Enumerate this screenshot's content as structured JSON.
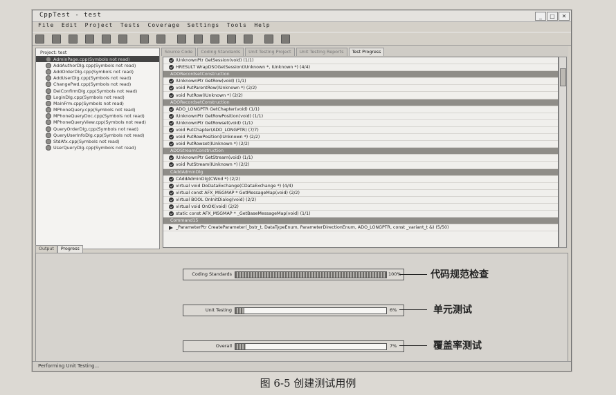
{
  "window": {
    "title": "CppTest - test",
    "controls": [
      "_",
      "□",
      "✕"
    ]
  },
  "menu": [
    "File",
    "Edit",
    "Project",
    "Tests",
    "Coverage",
    "Settings",
    "Tools",
    "Help"
  ],
  "tree": {
    "root": "Project: test",
    "items": [
      "AdminPage.cpp(Symbols not read)",
      "AddAuthorDlg.cpp(Symbols not read)",
      "AddOrderDlg.cpp(Symbols not read)",
      "AddUserDlg.cpp(Symbols not read)",
      "ChangePwd.cpp(Symbols not read)",
      "DelConfirmDlg.cpp(Symbols not read)",
      "LoginDlg.cpp(Symbols not read)",
      "MainFrm.cpp(Symbols not read)",
      "MPhoneQuery.cpp(Symbols not read)",
      "MPhoneQueryDoc.cpp(Symbols not read)",
      "MPhoneQueryView.cpp(Symbols not read)",
      "QueryOrderDlg.cpp(Symbols not read)",
      "QueryUserInfoDlg.cpp(Symbols not read)",
      "StdAfx.cpp(Symbols not read)",
      "UserQueryDlg.cpp(Symbols not read)"
    ]
  },
  "tabs": [
    "Source Code",
    "Coding Standards",
    "Unit Testing Project",
    "Unit Testing Reports",
    "Test Progress"
  ],
  "active_tab": "Test Progress",
  "test_rows": [
    {
      "kind": "test",
      "text": "IUnknownPtr GetSession(void) (1/1)"
    },
    {
      "kind": "test",
      "text": "HRESULT WrapDSOGetSession(IUnknown *, IUnknown *) (4/4)"
    },
    {
      "kind": "group",
      "text": "ADORecordsetConstruction"
    },
    {
      "kind": "test",
      "text": "IUnknownPtr GetRow(void) (1/1)"
    },
    {
      "kind": "test",
      "text": "void PutParentRow(IUnknown *) (2/2)"
    },
    {
      "kind": "test",
      "text": "void PutRow(IUnknown *) (2/2)"
    },
    {
      "kind": "group",
      "text": "ADORecordsetConstruction"
    },
    {
      "kind": "test",
      "text": "ADO_LONGPTR GetChapter(void) (1/1)"
    },
    {
      "kind": "test",
      "text": "IUnknownPtr GetRowPosition(void) (1/1)"
    },
    {
      "kind": "test",
      "text": "IUnknownPtr GetRowset(void) (1/1)"
    },
    {
      "kind": "test",
      "text": "void PutChapter(ADO_LONGPTR) (7/7)"
    },
    {
      "kind": "test",
      "text": "void PutRowPosition(IUnknown *) (2/2)"
    },
    {
      "kind": "test",
      "text": "void PutRowset(IUnknown *) (2/2)"
    },
    {
      "kind": "group",
      "text": "ADOStreamConstruction"
    },
    {
      "kind": "test",
      "text": "IUnknownPtr GetStream(void) (1/1)"
    },
    {
      "kind": "test",
      "text": "void PutStream(IUnknown *) (2/2)"
    },
    {
      "kind": "group",
      "text": "CAddAdminDlg"
    },
    {
      "kind": "test",
      "text": "CAddAdminDlg(CWnd *) (2/2)"
    },
    {
      "kind": "test",
      "text": "virtual void DoDataExchange(CDataExchange *) (4/4)"
    },
    {
      "kind": "test",
      "text": "virtual const AFX_MSGMAP * GetMessageMap(void) (2/2)"
    },
    {
      "kind": "test",
      "text": "virtual BOOL OnInitDialog(void) (2/2)"
    },
    {
      "kind": "test",
      "text": "virtual void OnOK(void) (2/2)"
    },
    {
      "kind": "test",
      "text": "static const AFX_MSGMAP * _GetBaseMessageMap(void) (1/1)"
    },
    {
      "kind": "group",
      "text": "Command15"
    },
    {
      "kind": "current",
      "text": "_ParameterPtr CreateParameter(_bstr_t, DataTypeEnum, ParameterDirectionEnum, ADO_LONGPTR, const _variant_t &) (5/50)"
    }
  ],
  "bottom_tabs": [
    "Output",
    "Progress"
  ],
  "progress": [
    {
      "label": "Coding Standards",
      "value": 1.0,
      "value_text": "100%",
      "annotation": "代码规范检查"
    },
    {
      "label": "Unit Testing",
      "value": 0.06,
      "value_text": "6%",
      "annotation": "单元测试"
    },
    {
      "label": "Overall",
      "value": 0.07,
      "value_text": "7%",
      "annotation": "覆盖率测试"
    }
  ],
  "status": "Performing Unit Testing...",
  "caption": "图 6-5    创建测试用例"
}
